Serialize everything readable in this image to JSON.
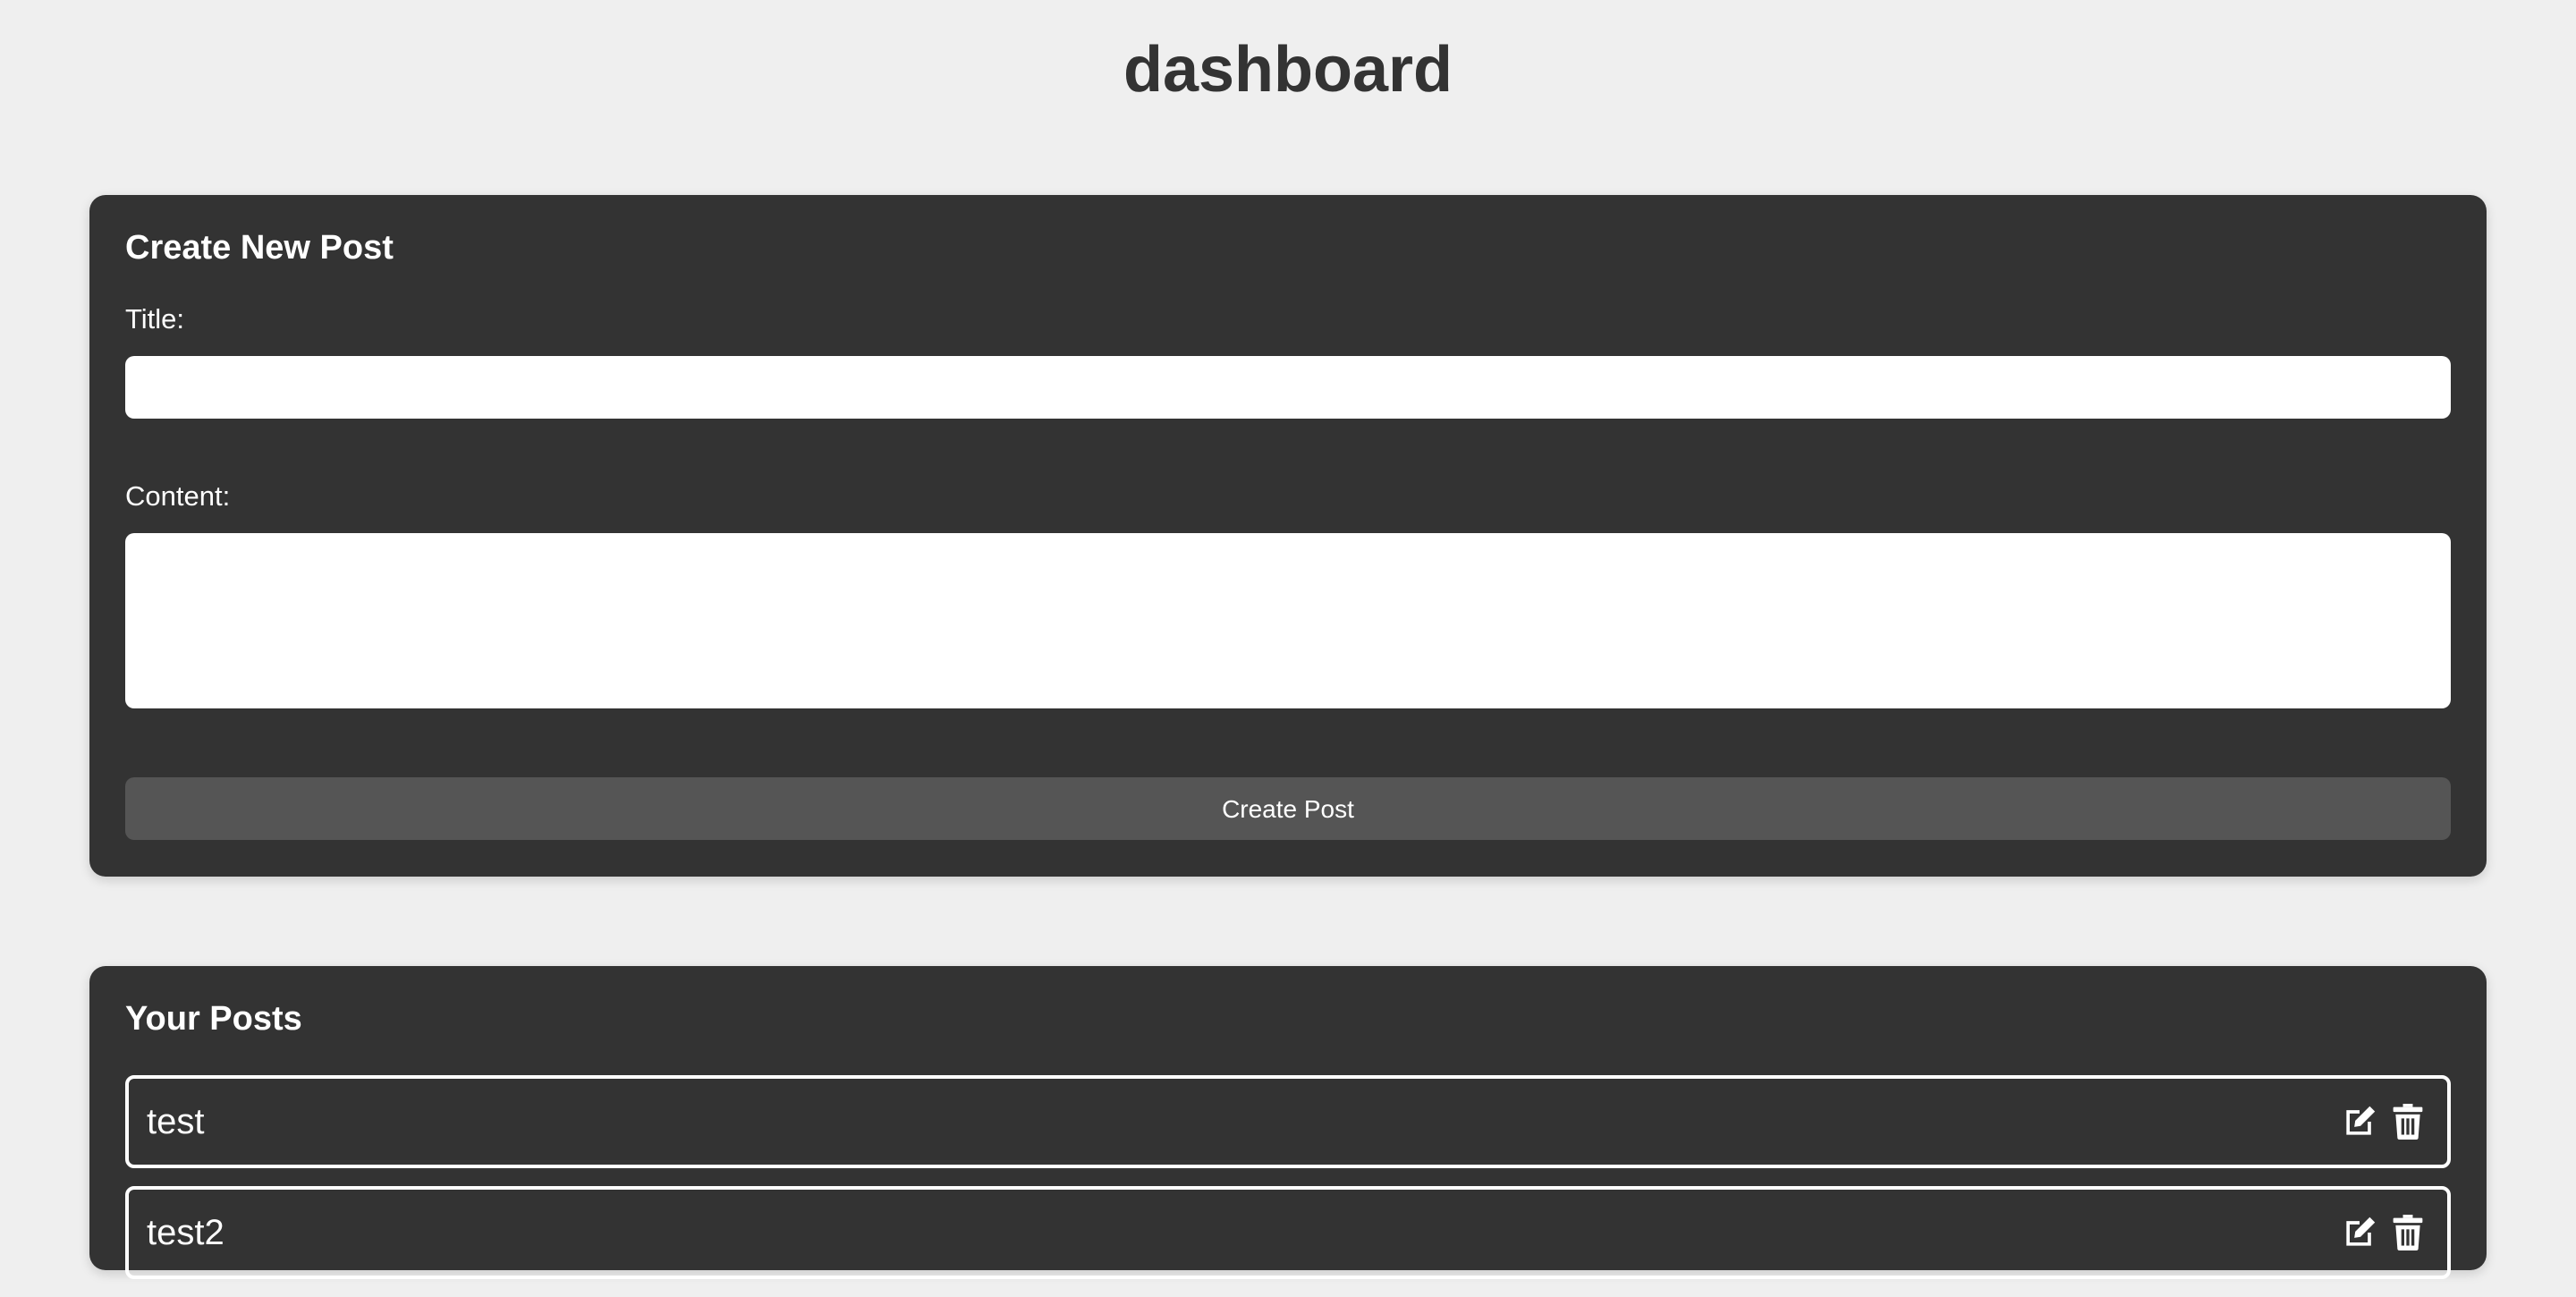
{
  "page": {
    "title": "dashboard"
  },
  "create_post": {
    "heading": "Create New Post",
    "title_label": "Title:",
    "title_value": "",
    "content_label": "Content:",
    "content_value": "",
    "submit_label": "Create Post"
  },
  "posts": {
    "heading": "Your Posts",
    "items": [
      {
        "title": "test",
        "edit_icon": "edit-icon",
        "delete_icon": "trash-icon"
      },
      {
        "title": "test2",
        "edit_icon": "edit-icon",
        "delete_icon": "trash-icon"
      }
    ]
  },
  "colors": {
    "page_background": "#efefef",
    "card_background": "#333333",
    "button_background": "#555555",
    "text_dark": "#333333",
    "text_light": "#ffffff"
  }
}
